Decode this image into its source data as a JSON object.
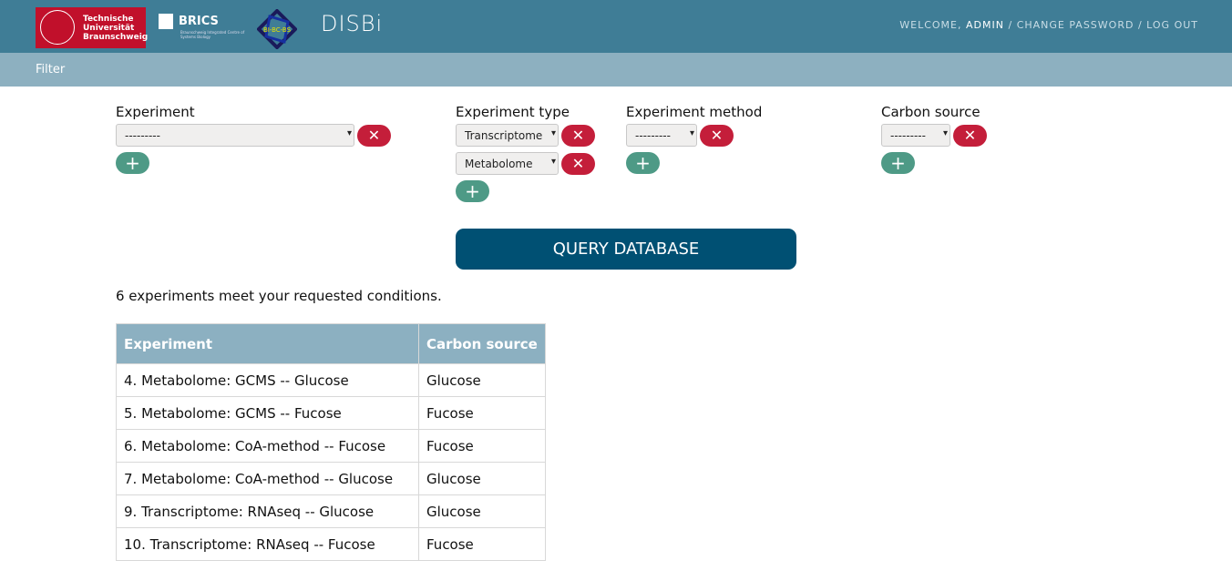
{
  "header": {
    "logos": {
      "tu": "Technische Universität Braunschweig",
      "brics": "BRICS",
      "brics_sub": "Braunschweig Integrated Centre of Systems Biology",
      "bibcbs": "BI-BC-BS"
    },
    "title": "DISBi",
    "user": {
      "welcome": "WELCOME,",
      "username": "ADMIN",
      "change_password": "CHANGE PASSWORD",
      "logout": "LOG OUT",
      "sep": "/"
    }
  },
  "subnav": {
    "filter": "Filter"
  },
  "filters": {
    "experiment": {
      "label": "Experiment",
      "selects": [
        "---------"
      ]
    },
    "experiment_type": {
      "label": "Experiment type",
      "selects": [
        "Transcriptome",
        "Metabolome"
      ]
    },
    "experiment_method": {
      "label": "Experiment method",
      "selects": [
        "---------"
      ]
    },
    "carbon_source": {
      "label": "Carbon source",
      "selects": [
        "---------"
      ]
    },
    "remove_icon": "✕",
    "add_icon": "+"
  },
  "query_button": "QUERY DATABASE",
  "result_count": "6 experiments meet your requested conditions.",
  "table": {
    "headers": [
      "Experiment",
      "Carbon source"
    ],
    "rows": [
      [
        "4. Metabolome: GCMS -- Glucose",
        "Glucose"
      ],
      [
        "5. Metabolome: GCMS -- Fucose",
        "Fucose"
      ],
      [
        "6. Metabolome: CoA-method -- Fucose",
        "Fucose"
      ],
      [
        "7. Metabolome: CoA-method -- Glucose",
        "Glucose"
      ],
      [
        "9. Transcriptome: RNAseq -- Glucose",
        "Glucose"
      ],
      [
        "10. Transcriptome: RNAseq -- Fucose",
        "Fucose"
      ]
    ]
  },
  "colors": {
    "header": "#3f7d96",
    "subnav": "#8db0c0",
    "primary": "#005073",
    "remove": "#c41e3a",
    "add": "#4e9a86"
  }
}
